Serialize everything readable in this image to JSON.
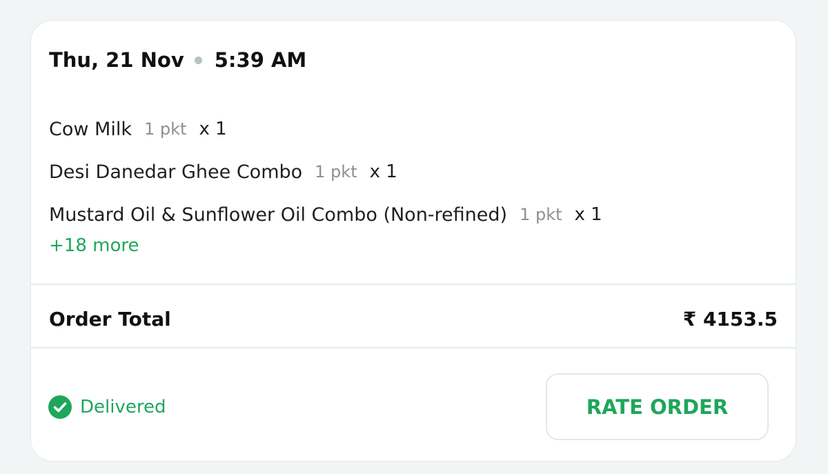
{
  "order": {
    "date": "Thu, 21 Nov",
    "time": "5:39 AM",
    "items": [
      {
        "name": "Cow Milk",
        "unit": "1 pkt",
        "count": "x 1"
      },
      {
        "name": "Desi Danedar Ghee Combo",
        "unit": "1 pkt",
        "count": "x 1"
      },
      {
        "name": "Mustard Oil & Sunflower Oil Combo (Non-refined)",
        "unit": "1 pkt",
        "count": "x 1"
      }
    ],
    "more_label": "+18 more",
    "total_label": "Order Total",
    "total_value": "₹ 4153.5",
    "status": "Delivered",
    "status_icon": "check-circle-icon",
    "rate_button": "RATE ORDER"
  },
  "colors": {
    "accent": "#1fa65a",
    "text": "#111111",
    "muted": "#8f8f8f",
    "background": "#f2f5f5",
    "card": "#ffffff"
  }
}
